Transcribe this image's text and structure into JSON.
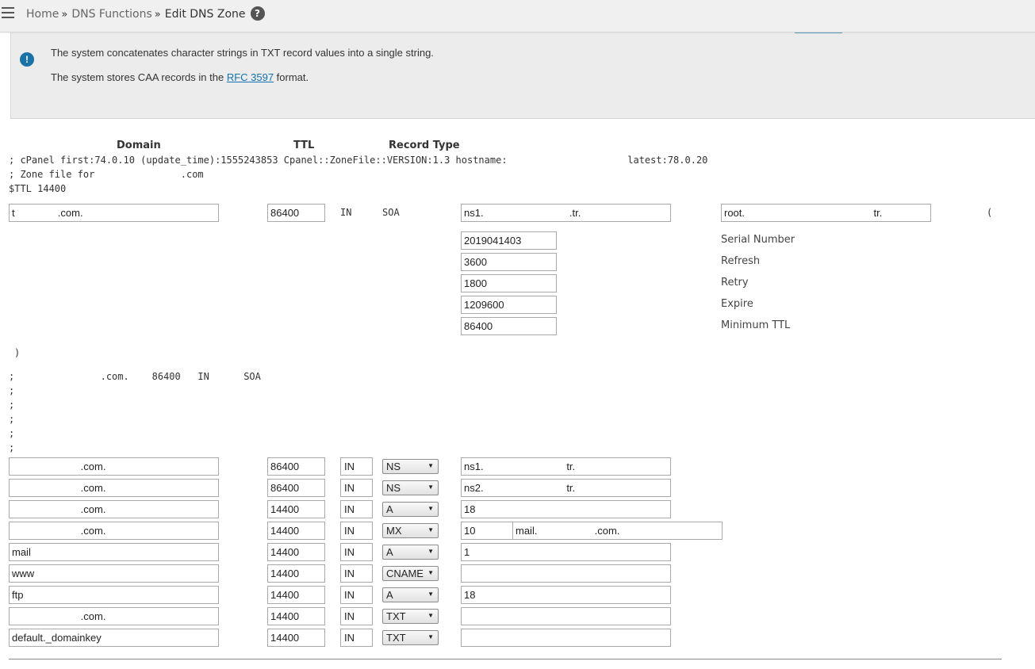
{
  "header": {
    "breadcrumb": [
      {
        "label": "Home",
        "sep": "»"
      },
      {
        "label": "DNS Functions",
        "sep": "»"
      },
      {
        "label": "Edit DNS Zone"
      }
    ],
    "help_icon": "?"
  },
  "notice": {
    "icon": "!",
    "line1": "The system concatenates character strings in TXT record values into a single string.",
    "line2_before": "The system stores CAA records in the ",
    "line2_link": "RFC 3597",
    "line2_after": " format."
  },
  "columns": {
    "domain": "Domain",
    "ttl": "TTL",
    "record_type": "Record Type"
  },
  "zone_comments": {
    "line1": "; cPanel first:74.0.10 (update_time):1555243853 Cpanel::ZoneFile::VERSION:1.3 hostname:                     latest:78.0.20",
    "line2": "; Zone file for               .com",
    "line3": "$TTL 14400"
  },
  "soa": {
    "domain": "t               .com.",
    "ttl": "86400",
    "class": "IN",
    "type": "SOA",
    "primary_ns": "ns1.                              .tr.",
    "admin_email": "root.                                             tr.",
    "open_paren": "(",
    "close_paren": ")",
    "fields": [
      {
        "value": "2019041403",
        "label": "Serial Number"
      },
      {
        "value": "3600",
        "label": "Refresh"
      },
      {
        "value": "1800",
        "label": "Retry"
      },
      {
        "value": "1209600",
        "label": "Expire"
      },
      {
        "value": "86400",
        "label": "Minimum TTL"
      }
    ]
  },
  "soa_comments": {
    "line1": ";               .com.    86400   IN      SOA",
    "line2": ";",
    "line3": ";",
    "line4": ";",
    "line5": ";",
    "line6": ";"
  },
  "records": [
    {
      "domain": "                        .com.",
      "ttl": "86400",
      "class": "IN",
      "type": "NS",
      "value": "ns1.                             tr."
    },
    {
      "domain": "                        .com.",
      "ttl": "86400",
      "class": "IN",
      "type": "NS",
      "value": "ns2.                             tr."
    },
    {
      "domain": "                        .com.",
      "ttl": "14400",
      "class": "IN",
      "type": "A",
      "value": "18"
    },
    {
      "domain": "                        .com.",
      "ttl": "14400",
      "class": "IN",
      "type": "MX",
      "priority": "10",
      "value": "mail.                    .com."
    },
    {
      "domain": "mail",
      "ttl": "14400",
      "class": "IN",
      "type": "A",
      "value": "1"
    },
    {
      "domain": "www",
      "ttl": "14400",
      "class": "IN",
      "type": "CNAME",
      "value": ""
    },
    {
      "domain": "ftp",
      "ttl": "14400",
      "class": "IN",
      "type": "A",
      "value": "18"
    },
    {
      "domain": "                        .com.",
      "ttl": "14400",
      "class": "IN",
      "type": "TXT",
      "value": ""
    },
    {
      "domain": "default._domainkey",
      "ttl": "14400",
      "class": "IN",
      "type": "TXT",
      "value": ""
    }
  ]
}
